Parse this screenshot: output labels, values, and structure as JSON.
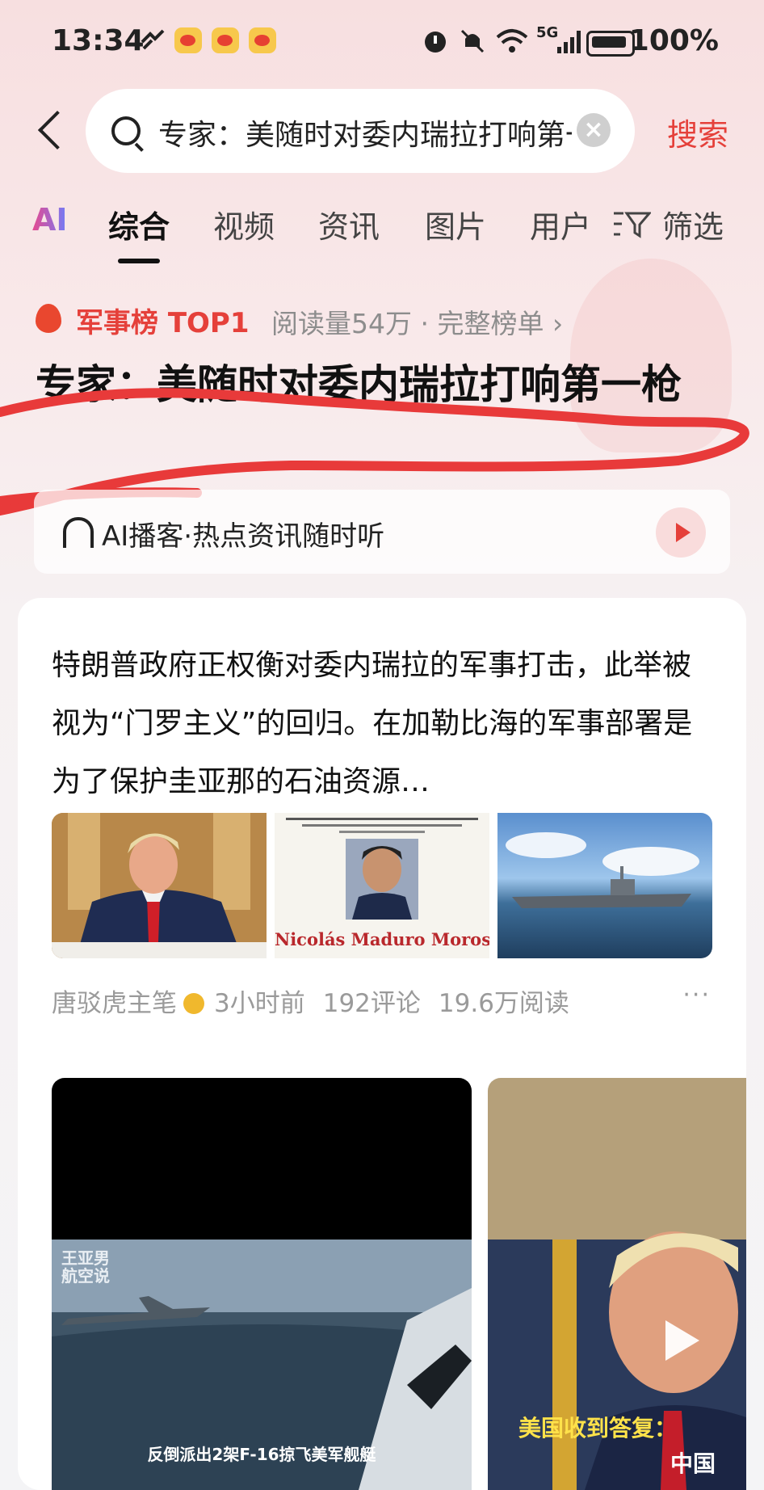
{
  "status_bar": {
    "time": "13:34",
    "battery": "100%",
    "network": "5G",
    "icons": [
      "link-icon",
      "weibo-icon",
      "weibo-icon",
      "weibo-icon",
      "alarm-icon",
      "mute-icon",
      "wifi-icon",
      "signal-icon",
      "battery-icon"
    ]
  },
  "search": {
    "query": "专家：美随时对委内瑞拉打响第一枪",
    "submit_label": "搜索"
  },
  "tabs": [
    "AI",
    "综合",
    "视频",
    "资讯",
    "图片",
    "用户"
  ],
  "active_tab": "综合",
  "filter_label": "筛选",
  "hot": {
    "rank_label": "军事榜 TOP1",
    "meta": "阅读量54万 · 完整榜单 ›",
    "headline": "专家：美随时对委内瑞拉打响第一枪"
  },
  "podcast": {
    "label": "AI播客·热点资讯随时听"
  },
  "article": {
    "summary": "特朗普政府正权衡对委内瑞拉的军事打击，此举被视为“门罗主义”的回归。在加勒比海的军事部署是为了保护圭亚那的石油资源…",
    "images": [
      {
        "name": "trump-press-photo"
      },
      {
        "name": "maduro-wanted-poster",
        "header": "FOR INFORMATION LEADING TO THE ARREST AND/OR CONVICTION OF THE LEADER OF THE SPECIALLY DESIGNATED GLOBAL TERRORIST CARTEL DE LOS SOLES",
        "caption": "Nicolás Maduro Moros"
      },
      {
        "name": "warship-photo"
      }
    ],
    "author": "唐驳虎主笔",
    "time": "3小时前",
    "comments": "192评论",
    "reads": "19.6万阅读",
    "more": "···"
  },
  "videos": [
    {
      "watermark": "王亚男\n航空说",
      "caption": "反倒派出2架F-16掠飞美军舰艇"
    },
    {
      "caption_line1": "美国收到答复：",
      "caption_line2": "中国"
    }
  ]
}
